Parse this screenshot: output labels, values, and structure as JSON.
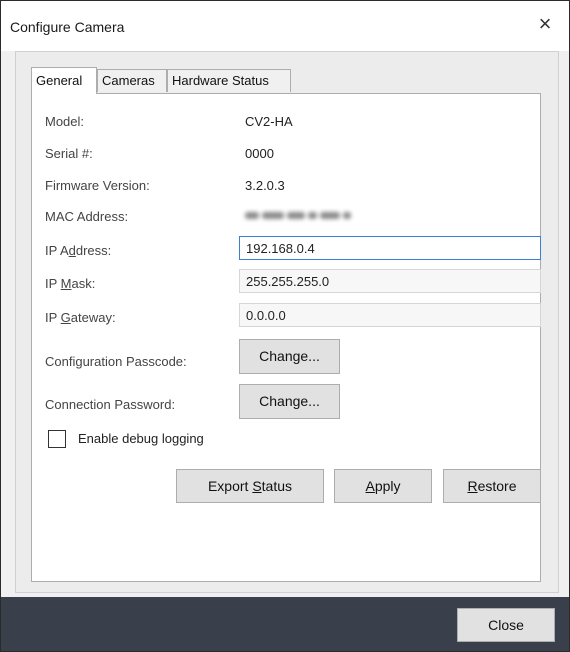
{
  "window": {
    "title": "Configure Camera",
    "close_glyph": "×"
  },
  "tabs": [
    {
      "label": "General",
      "active": true
    },
    {
      "label": "Cameras",
      "active": false
    },
    {
      "label": "Hardware Status",
      "active": false
    }
  ],
  "general": {
    "model_label": "Model:",
    "model_value": "CV2-HA",
    "serial_label": "Serial #:",
    "serial_value": "0000",
    "firmware_label": "Firmware Version:",
    "firmware_value": "3.2.0.3",
    "mac_label": "MAC Address:",
    "ip_address_label_pre": "IP A",
    "ip_address_label_mn": "d",
    "ip_address_label_post": "dress:",
    "ip_address_value": "192.168.0.4",
    "ip_mask_label_pre": "IP ",
    "ip_mask_label_mn": "M",
    "ip_mask_label_post": "ask:",
    "ip_mask_value": "255.255.255.0",
    "ip_gateway_label_pre": "IP ",
    "ip_gateway_label_mn": "G",
    "ip_gateway_label_post": "ateway:",
    "ip_gateway_value": "0.0.0.0",
    "config_passcode_label": "Configuration Passcode:",
    "config_passcode_button": "Change...",
    "connection_password_label": "Connection Password:",
    "connection_password_button": "Change...",
    "debug_logging_label": "Enable debug logging",
    "debug_logging_checked": false
  },
  "actions": {
    "export_pre": "Export ",
    "export_mn": "S",
    "export_post": "tatus",
    "apply_mn": "A",
    "apply_post": "pply",
    "restore_mn": "R",
    "restore_post": "estore"
  },
  "footer": {
    "close_label": "Close"
  },
  "colors": {
    "focus_border": "#3b7fd4",
    "bottom_strip": "#3a3f4c",
    "button_face": "#e1e1e1"
  }
}
